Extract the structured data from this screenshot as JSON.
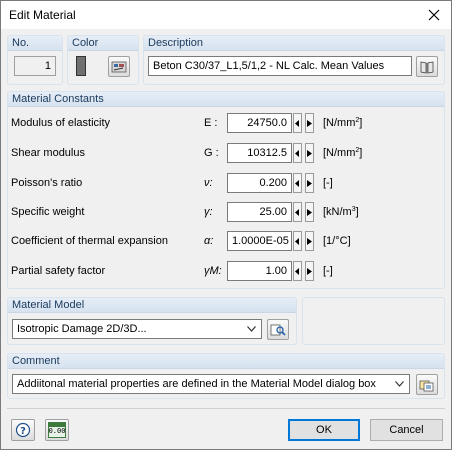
{
  "window": {
    "title": "Edit Material"
  },
  "header": {
    "no_label": "No.",
    "no_value": "1",
    "color_label": "Color",
    "description_label": "Description",
    "description_value": "Beton C30/37_L1,5/1,2 - NL Calc. Mean Values"
  },
  "constants": {
    "title": "Material Constants",
    "rows": [
      {
        "label": "Modulus of elasticity",
        "symbol": "E :",
        "value": "24750.0",
        "unit": "[N/mm",
        "unit_sup": "2",
        "unit_end": "]"
      },
      {
        "label": "Shear modulus",
        "symbol": "G :",
        "value": "10312.5",
        "unit": "[N/mm",
        "unit_sup": "2",
        "unit_end": "]"
      },
      {
        "label": "Poisson's ratio",
        "symbol": "ν:",
        "value": "0.200",
        "unit": "[-]",
        "unit_sup": "",
        "unit_end": ""
      },
      {
        "label": "Specific weight",
        "symbol": "γ:",
        "value": "25.00",
        "unit": "[kN/m",
        "unit_sup": "3",
        "unit_end": "]"
      },
      {
        "label": "Coefficient of thermal expansion",
        "symbol": "α:",
        "value": "1.0000E-05",
        "unit": "[1/°C]",
        "unit_sup": "",
        "unit_end": ""
      },
      {
        "label": "Partial safety factor",
        "symbol": "γM:",
        "value": "1.00",
        "unit": "[-]",
        "unit_sup": "",
        "unit_end": ""
      }
    ]
  },
  "model": {
    "title": "Material Model",
    "selected": "Isotropic Damage 2D/3D..."
  },
  "comment": {
    "title": "Comment",
    "value": "Addiitonal material properties are defined in the Material Model dialog box"
  },
  "footer": {
    "calc_icon_text": "0.00",
    "ok_label": "OK",
    "cancel_label": "Cancel"
  },
  "colors": {
    "group_header": "#d6e2ef",
    "material_color": "#707070"
  }
}
